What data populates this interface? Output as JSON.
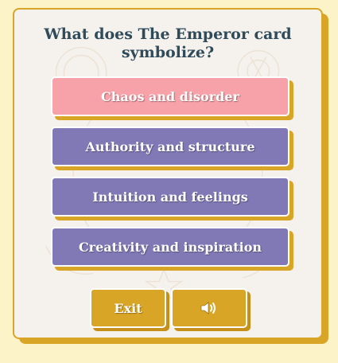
{
  "quiz": {
    "question": "What does The Emperor card symbolize?",
    "answers": [
      {
        "label": "Chaos and disorder",
        "state": "wrong"
      },
      {
        "label": "Authority and structure",
        "state": "normal"
      },
      {
        "label": "Intuition and feelings",
        "state": "normal"
      },
      {
        "label": "Creativity and inspiration",
        "state": "normal"
      }
    ]
  },
  "controls": {
    "exit_label": "Exit",
    "sound_icon": "speaker-volume-icon"
  },
  "colors": {
    "background": "#fdf3c8",
    "card": "#f5f1ec",
    "gold": "#d9a526",
    "purple": "#8179b5",
    "wrong_pink": "#f7a2a8",
    "question_text": "#2f4b5a"
  }
}
